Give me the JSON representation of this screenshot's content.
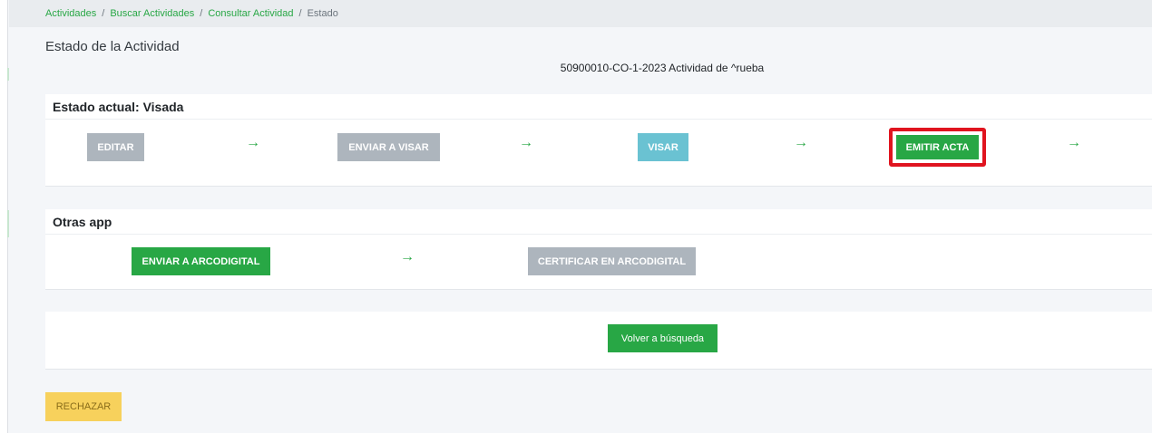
{
  "breadcrumb": {
    "items": [
      "Actividades",
      "Buscar Actividades",
      "Consultar Actividad"
    ],
    "separator": "/",
    "current": "Estado"
  },
  "page": {
    "title": "Estado de la Actividad",
    "activity": "50900010-CO-1-2023 Actividad de ^rueba"
  },
  "estado": {
    "header": "Estado actual: Visada",
    "buttons": {
      "editar": "EDITAR",
      "enviar_visar": "ENVIAR A VISAR",
      "visar": "VISAR",
      "emitir_acta": "EMITIR ACTA"
    },
    "arrow_icon": "→"
  },
  "otras": {
    "header": "Otras app",
    "buttons": {
      "enviar_arcodigital": "ENVIAR A ARCODIGITAL",
      "certificar_arcodigital": "CERTIFICAR EN ARCODIGITAL"
    },
    "arrow_icon": "→"
  },
  "footer": {
    "volver": "Volver a búsqueda",
    "rechazar": "RECHAZAR"
  },
  "colors": {
    "accent_green": "#28a745",
    "disabled_gray": "#adb5bd",
    "info_blue": "#6ac2d2",
    "warning_yellow": "#f7d15c",
    "highlight_red": "#e0141f"
  }
}
